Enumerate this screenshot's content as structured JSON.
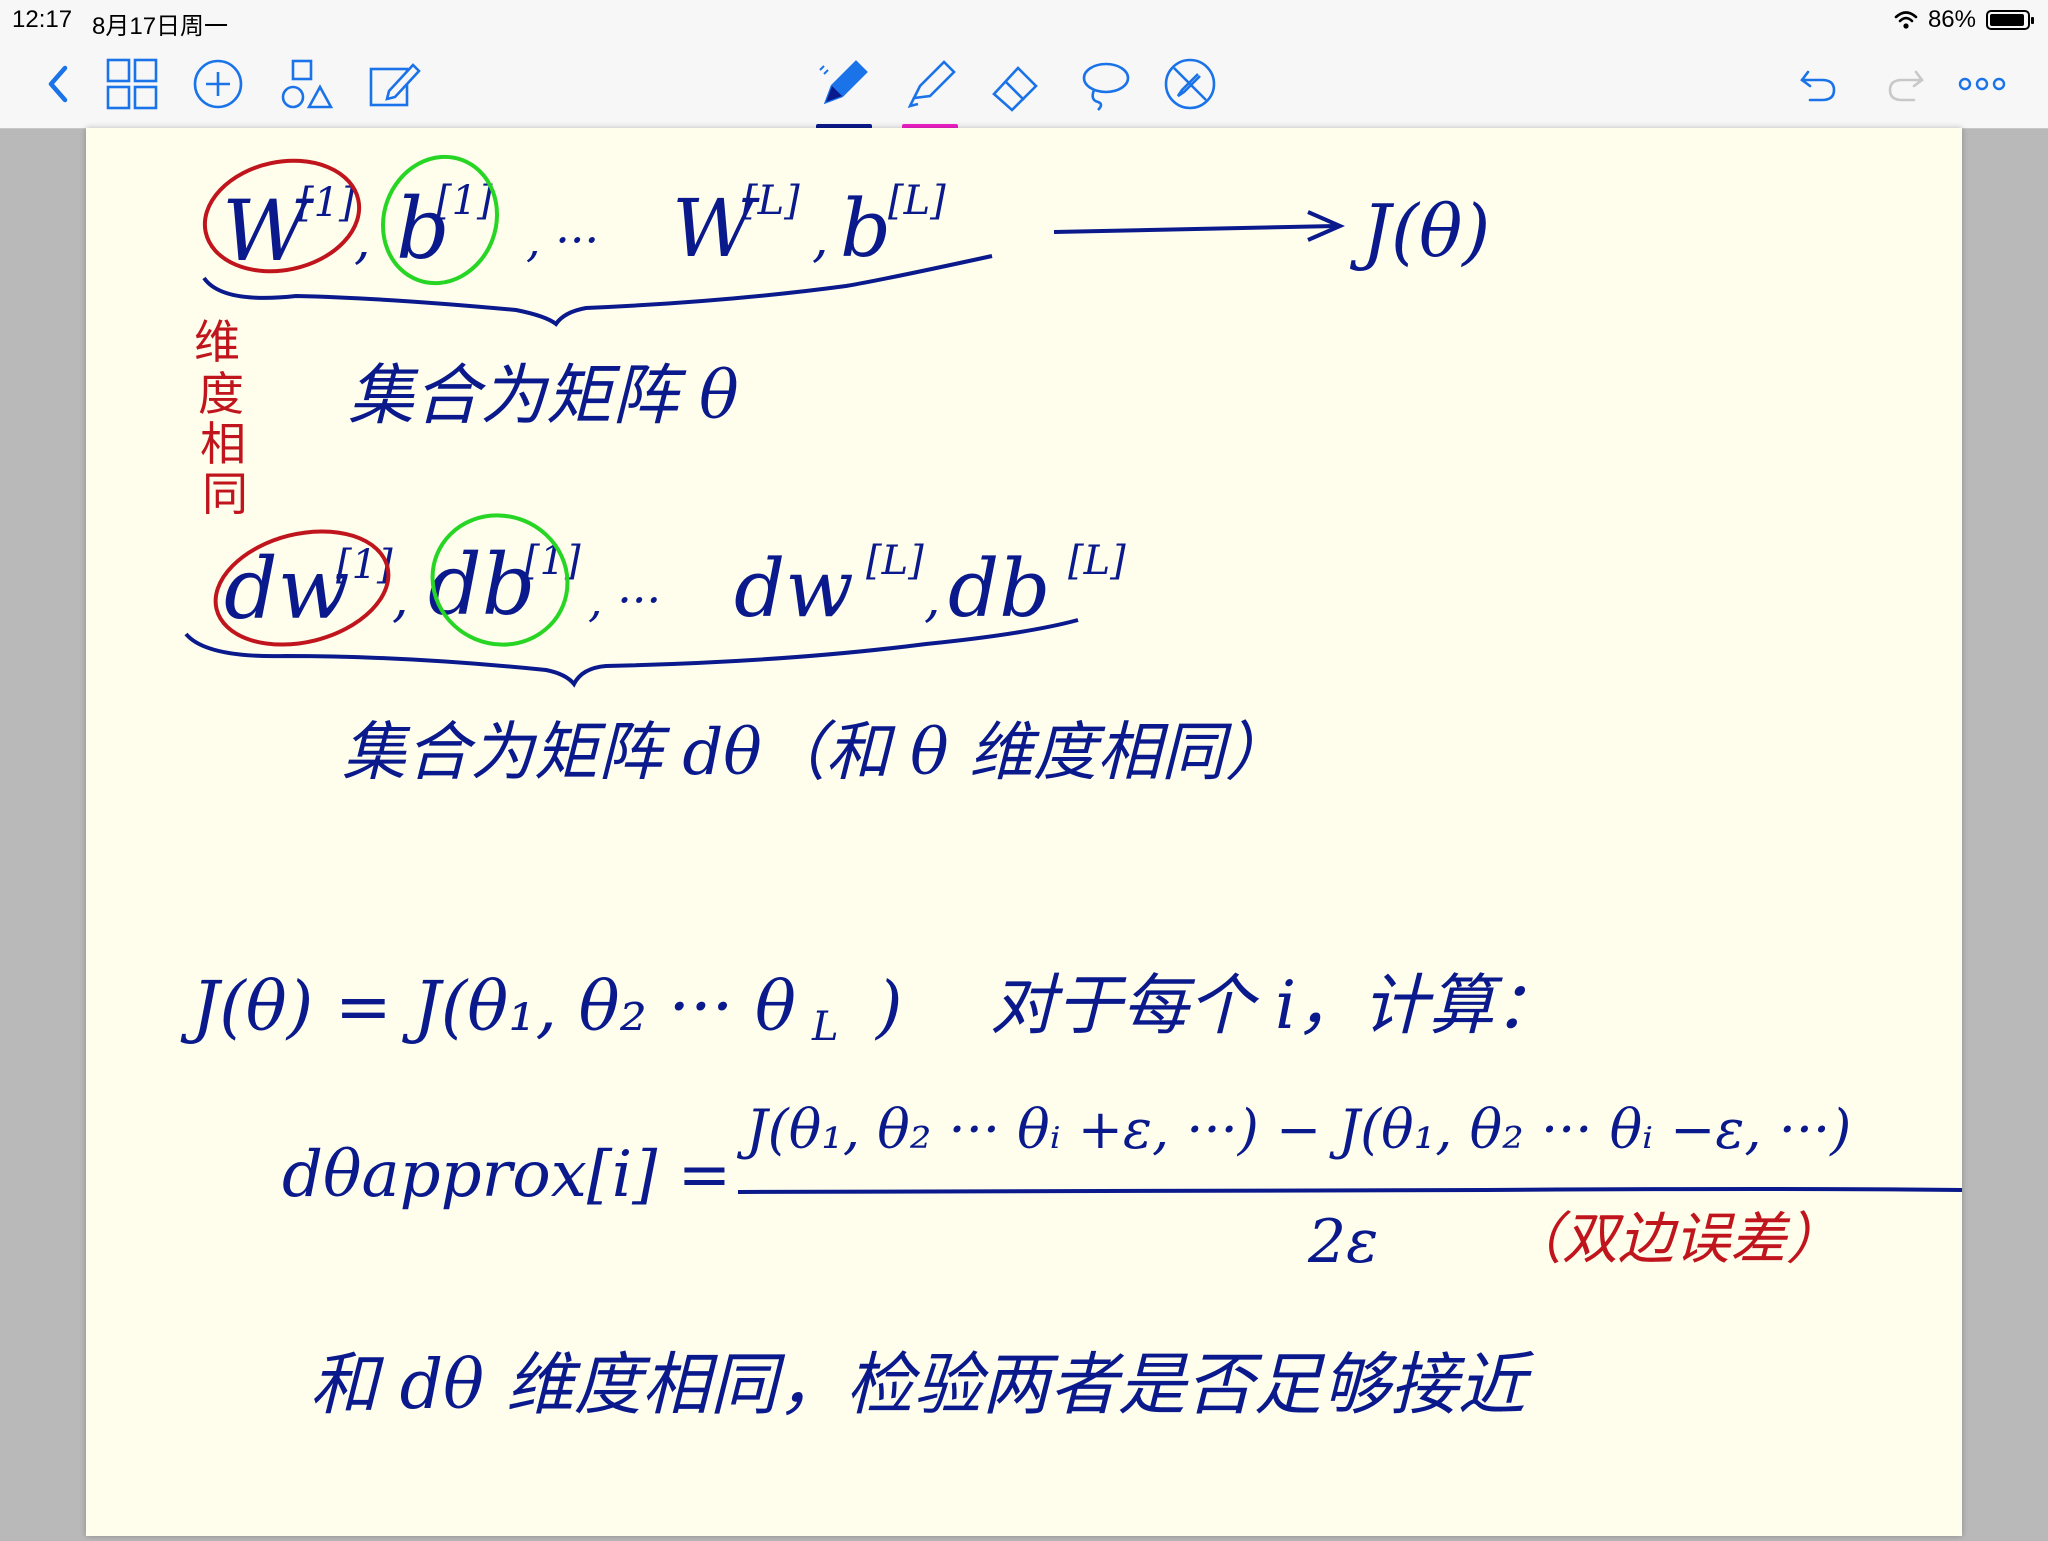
{
  "status": {
    "time": "12:17",
    "date": "8月17日周一",
    "battery_pct": "86%"
  },
  "toolbar": {
    "left_icons": [
      "back-chevron-icon",
      "grid-icon",
      "add-icon",
      "shapes-icon",
      "edit-icon"
    ],
    "center_tools": [
      {
        "name": "pen-tool",
        "underline_color": "#0a1a8c"
      },
      {
        "name": "highlighter-tool",
        "underline_color": "#f020c8"
      },
      {
        "name": "eraser-tool"
      },
      {
        "name": "lasso-tool"
      },
      {
        "name": "disable-touch-tool"
      }
    ],
    "right_icons": [
      "undo-icon",
      "redo-icon",
      "more-icon"
    ],
    "accent_color": "#1a73e8"
  },
  "note": {
    "line1": {
      "w1": "W",
      "w1_sup": "[1]",
      "b1": "b",
      "b1_sup": "[1]",
      "dots": ", ···",
      "wl": "W",
      "wl_sup": "[L]",
      "bl": "b",
      "bl_sup": "[L]",
      "arrow_target": "J(θ)"
    },
    "side_note": [
      "维",
      "度",
      "相",
      "同"
    ],
    "line2": "集合为矩阵 θ",
    "line3": {
      "dw1": "dw",
      "dw1_sup": "[1]",
      "db1": "db",
      "db1_sup": "[1]",
      "dots": ", ···",
      "dwl": "dw",
      "dwl_sup": "[L]",
      "dbl": "db",
      "dbl_sup": "[L]"
    },
    "line4": "集合为矩阵 dθ（和 θ 维度相同）",
    "line5_left": "J(θ) = J(θ₁, θ₂ ··· θ",
    "line5_sub": "L",
    "line5_close": ")",
    "line5_right": "对于每个 i，计算：",
    "formula_lhs": "dθapprox[i] =",
    "numerator": "J(θ₁, θ₂ ··· θᵢ +ε, ···) − J(θ₁, θ₂ ··· θᵢ −ε, ···)",
    "denominator": "2ε",
    "error_note": "（双边误差）",
    "line_last": "和 dθ 维度相同，检验两者是否足够接近"
  }
}
